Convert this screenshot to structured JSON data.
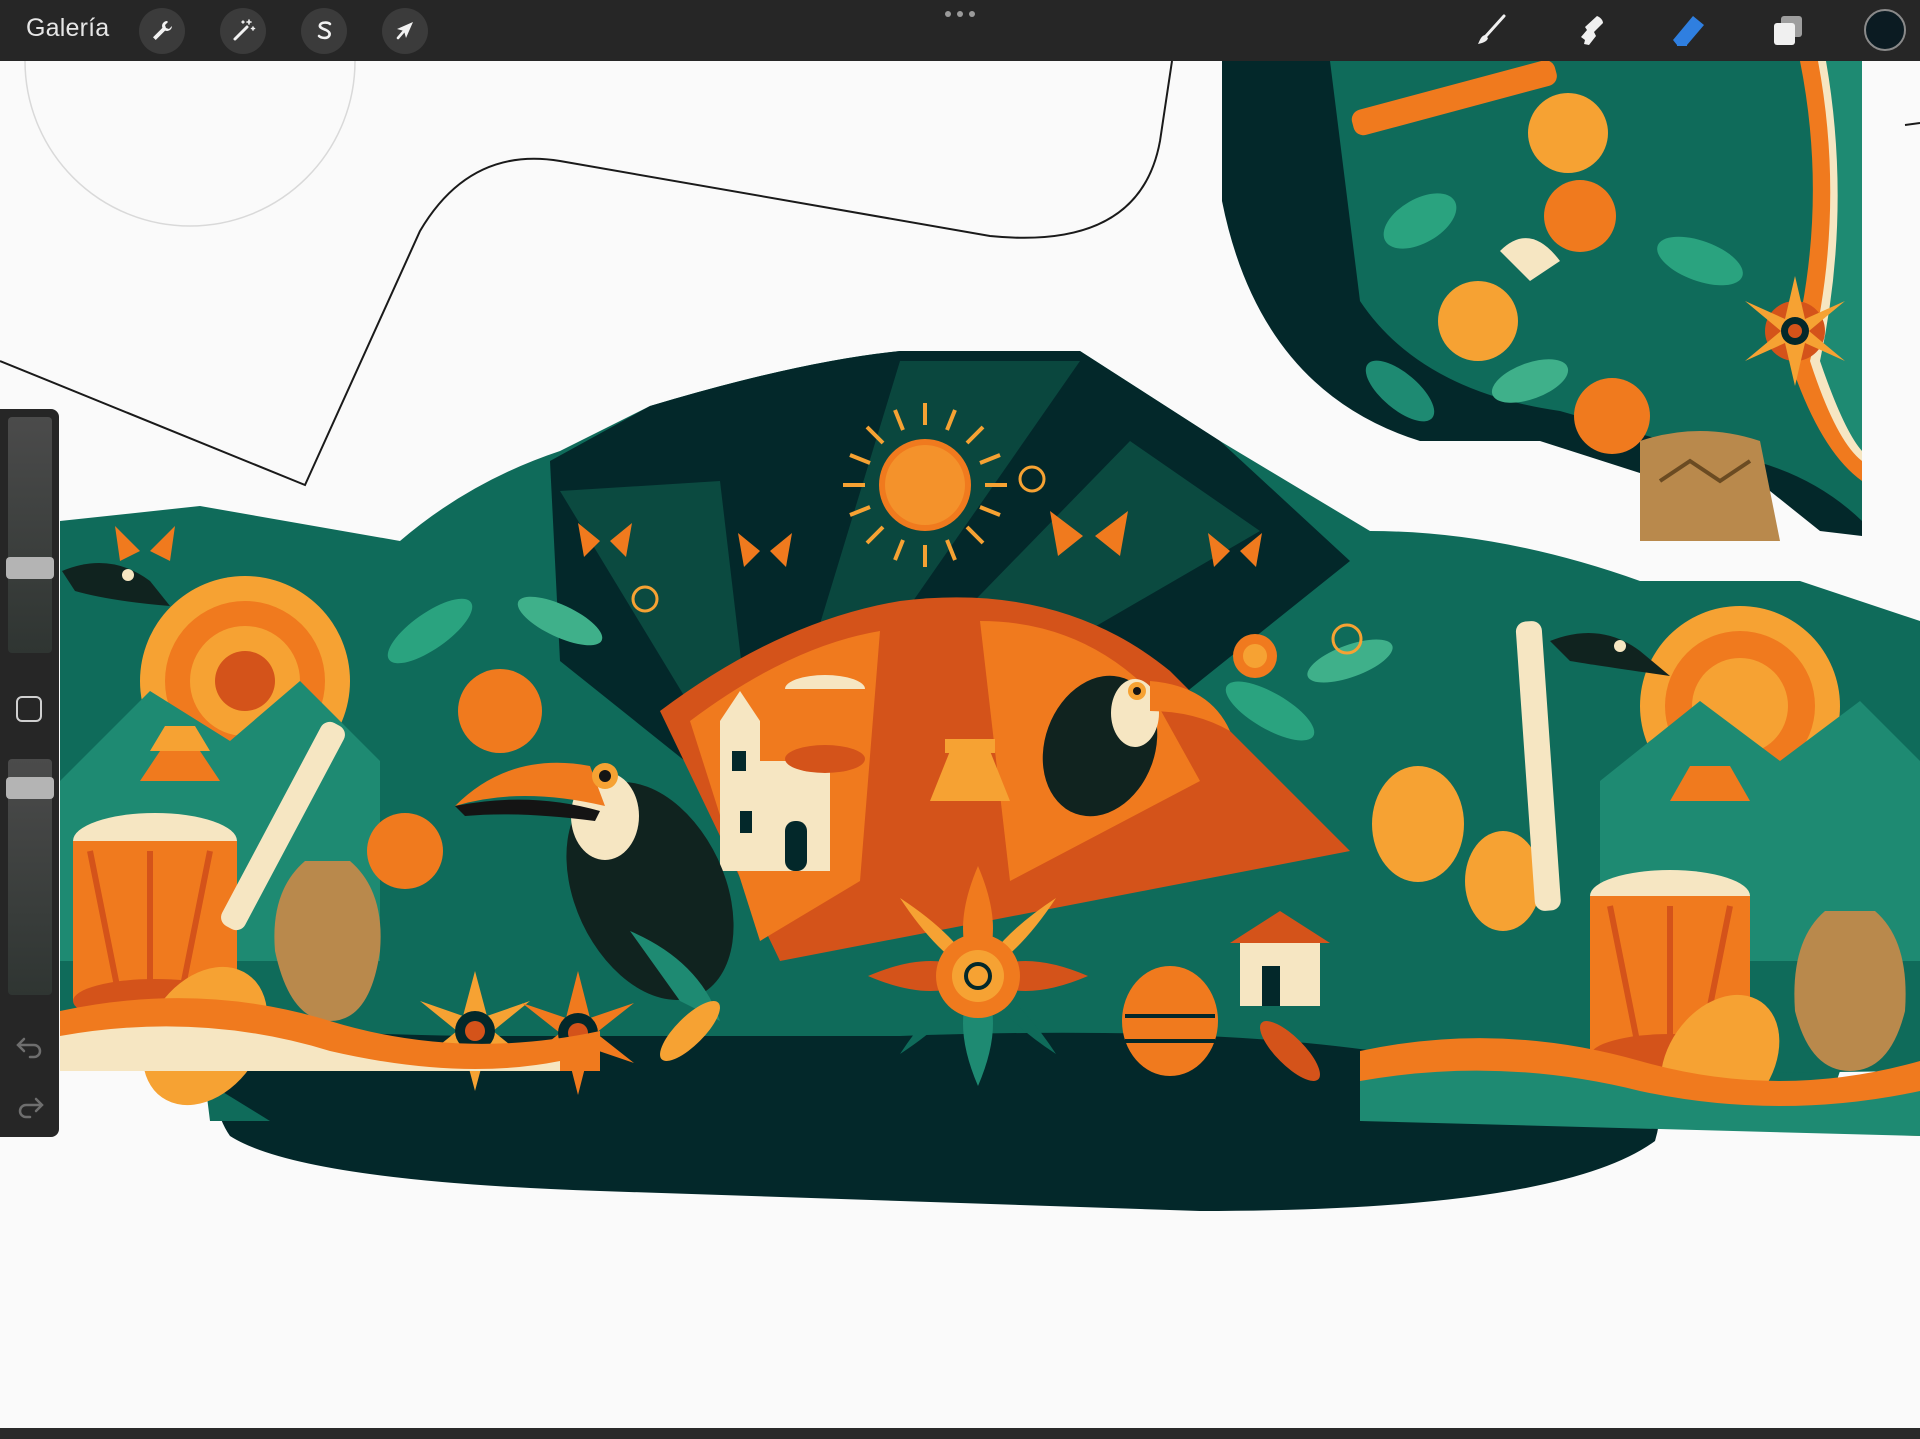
{
  "toolbar": {
    "gallery_label": "Galería",
    "left_tools": [
      {
        "name": "actions",
        "icon": "wrench-icon"
      },
      {
        "name": "adjustments",
        "icon": "magic-wand-icon"
      },
      {
        "name": "selection",
        "icon": "selection-s-icon"
      },
      {
        "name": "transform",
        "icon": "arrow-cursor-icon"
      }
    ],
    "right_tools": [
      {
        "name": "brush",
        "icon": "brush-icon",
        "active": false
      },
      {
        "name": "smudge",
        "icon": "smudge-icon",
        "active": false
      },
      {
        "name": "eraser",
        "icon": "eraser-icon",
        "active": true
      },
      {
        "name": "layers",
        "icon": "layers-icon",
        "active": false
      }
    ],
    "current_color": "#0b1b22",
    "active_tool_color": "#2f7fe0"
  },
  "sidebar": {
    "brush_size_level": 0.72,
    "opacity_level": 0.85,
    "icons": [
      "modify-square-icon",
      "undo-icon",
      "redo-icon"
    ]
  },
  "artwork": {
    "palette": {
      "deep_teal": "#03282a",
      "teal": "#0f6b5a",
      "mid_teal": "#1e8a72",
      "orange": "#f07a1e",
      "dark_orange": "#d4531a",
      "amber": "#f6a233",
      "cream": "#f6e6c2",
      "black": "#141414"
    }
  }
}
